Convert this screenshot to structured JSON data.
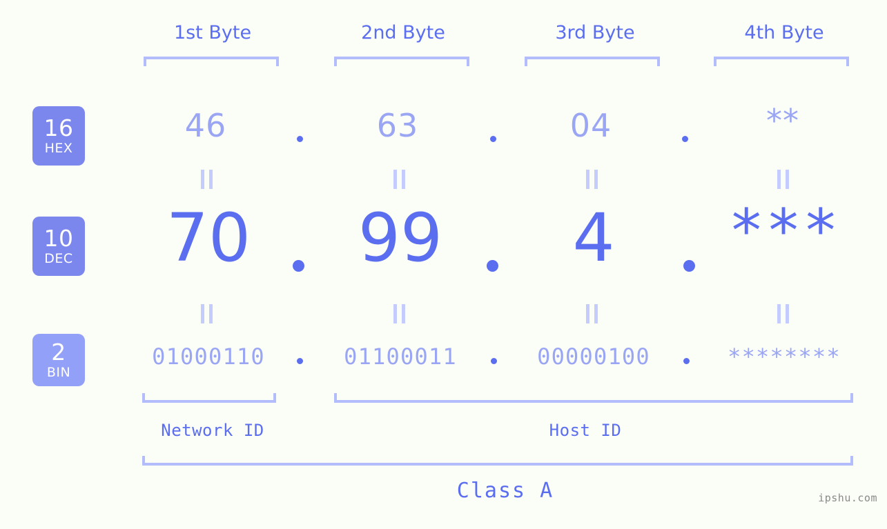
{
  "meta": {
    "watermark": "ipshu.com",
    "accent_strong": "#5b6ef0",
    "accent_light": "#9aa6f4",
    "accent_bracket": "#b3bdfb",
    "badge_fill": "#7b87ec",
    "badge_fill_light": "#93a0f7",
    "background": "#fbfdf7"
  },
  "headers": {
    "bytes": [
      {
        "label": "1st Byte"
      },
      {
        "label": "2nd Byte"
      },
      {
        "label": "3rd Byte"
      },
      {
        "label": "4th Byte"
      }
    ]
  },
  "rows": {
    "hex": {
      "badge_number": "16",
      "badge_name": "HEX",
      "values": [
        "46",
        "63",
        "04",
        "**"
      ],
      "separator": "."
    },
    "dec": {
      "badge_number": "10",
      "badge_name": "DEC",
      "values": [
        "70",
        "99",
        "4",
        "***"
      ],
      "separator": "."
    },
    "bin": {
      "badge_number": "2",
      "badge_name": "BIN",
      "values": [
        "01000110",
        "01100011",
        "00000100",
        "********"
      ],
      "separator": "."
    }
  },
  "equivalence_symbol": "||",
  "segments": {
    "network_id": "Network ID",
    "host_id": "Host ID",
    "class": "Class A"
  }
}
